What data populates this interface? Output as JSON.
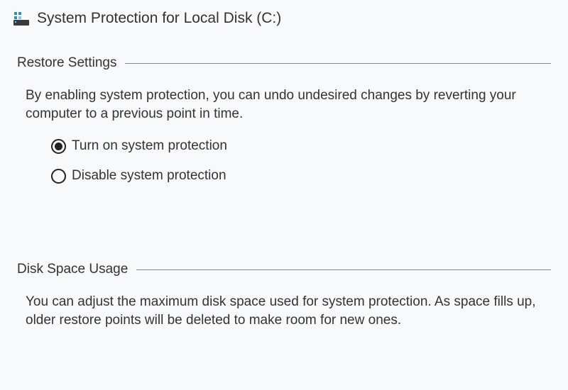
{
  "title": "System Protection for Local Disk (C:)",
  "restore": {
    "heading": "Restore Settings",
    "description": "By enabling system protection, you can undo undesired changes by reverting your computer to a previous point in time.",
    "options": {
      "turn_on": "Turn on system protection",
      "disable": "Disable system protection"
    },
    "selected": "turn_on"
  },
  "disk_usage": {
    "heading": "Disk Space Usage",
    "description": "You can adjust the maximum disk space used for system protection. As space fills up, older restore points will be deleted to make room for new ones."
  }
}
